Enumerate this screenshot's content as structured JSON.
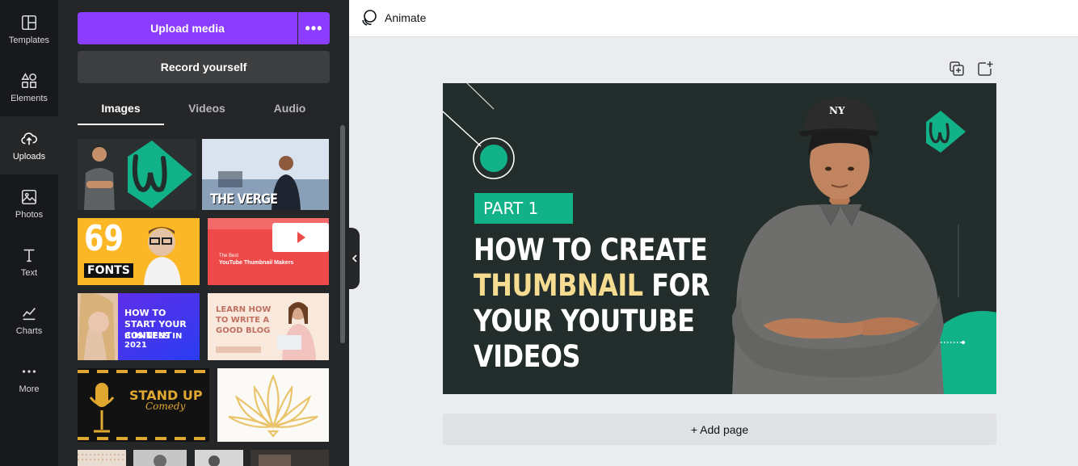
{
  "rail": {
    "items": [
      {
        "label": "Templates",
        "icon": "templates-icon"
      },
      {
        "label": "Elements",
        "icon": "elements-icon"
      },
      {
        "label": "Uploads",
        "icon": "uploads-icon"
      },
      {
        "label": "Photos",
        "icon": "photos-icon"
      },
      {
        "label": "Text",
        "icon": "text-icon"
      },
      {
        "label": "Charts",
        "icon": "charts-icon"
      },
      {
        "label": "More",
        "icon": "more-icon"
      }
    ]
  },
  "panel": {
    "upload_label": "Upload media",
    "more_label": "•••",
    "record_label": "Record yourself",
    "tabs": [
      {
        "label": "Images",
        "active": true
      },
      {
        "label": "Videos",
        "active": false
      },
      {
        "label": "Audio",
        "active": false
      }
    ],
    "thumbnails": [
      {
        "text": "",
        "caption": ""
      },
      {
        "text": "THE VERGE"
      },
      {
        "text": "69",
        "caption": "FONTS"
      },
      {
        "text": "The Best",
        "caption": "YouTube Thumbnail Makers"
      },
      {
        "text": "HOW TO START YOUR CONTENT",
        "caption": "BUSINESS IN 2021"
      },
      {
        "text": "LEARN HOW TO WRITE A GOOD BLOG",
        "caption": ""
      },
      {
        "text": "STAND UP",
        "caption": "Comedy"
      },
      {
        "text": ""
      }
    ]
  },
  "topbar": {
    "animate_label": "Animate"
  },
  "canvas": {
    "part_label": "PART 1",
    "headline_line1": "HOW TO CREATE",
    "headline_line2_highlight": "THUMBNAIL",
    "headline_line2_rest": " FOR",
    "headline_line3": "YOUR YOUTUBE",
    "headline_line4": "VIDEOS",
    "highlight_color": "#f6dc91",
    "accent_color": "#12b288",
    "background_color": "#232d2b"
  },
  "add_page_label": "+ Add page",
  "colors": {
    "brand_purple": "#8b3dff",
    "rail_bg": "#18191b",
    "panel_bg": "#252627"
  }
}
